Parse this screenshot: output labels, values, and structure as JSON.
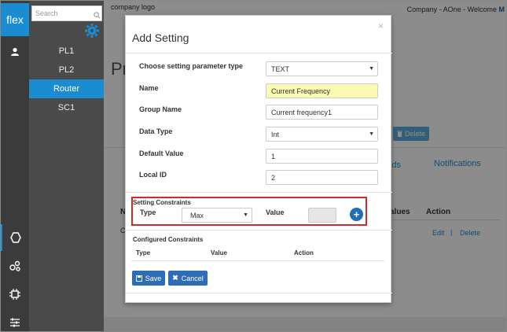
{
  "brand": {
    "label": "flex"
  },
  "sidebar": {
    "search_placeholder": "Search",
    "items": [
      {
        "label": "PL1"
      },
      {
        "label": "PL2"
      },
      {
        "label": "Router",
        "active": true
      },
      {
        "label": "SC1"
      }
    ]
  },
  "header": {
    "logo": "company logo",
    "company": "Company - AOne - Welcome ",
    "user_initial": "M"
  },
  "background": {
    "page_title": "Pr",
    "delete_label": "Delete",
    "tab_ids": "lds",
    "tab_notifications": "Notifications",
    "col_values": "alues",
    "col_action": "Action",
    "edit_link": "Edit",
    "separator": "|",
    "delete_link": "Delete",
    "side_n": "N",
    "side_c": "C"
  },
  "modal": {
    "title": "Add Setting",
    "close": "×",
    "fields": {
      "param_type_label": "Choose setting parameter type",
      "param_type_value": "TEXT",
      "name_label": "Name",
      "name_value": "Current Frequency",
      "group_label": "Group Name",
      "group_value": "Current frequency1",
      "datatype_label": "Data Type",
      "datatype_value": "Int",
      "default_label": "Default Value",
      "default_value": "1",
      "localid_label": "Local ID",
      "localid_value": "2"
    },
    "constraints": {
      "title": "Setting Constraints",
      "type_label": "Type",
      "type_value": "Max",
      "value_label": "Value",
      "value_value": ""
    },
    "configured": {
      "title": "Configured Constraints",
      "col_type": "Type",
      "col_value": "Value",
      "col_action": "Action"
    },
    "buttons": {
      "save": "Save",
      "cancel": "Cancel"
    }
  },
  "colors": {
    "accent": "#1a8ccf",
    "primary_button": "#2d6db6",
    "highlight_border": "#d12a2a"
  }
}
